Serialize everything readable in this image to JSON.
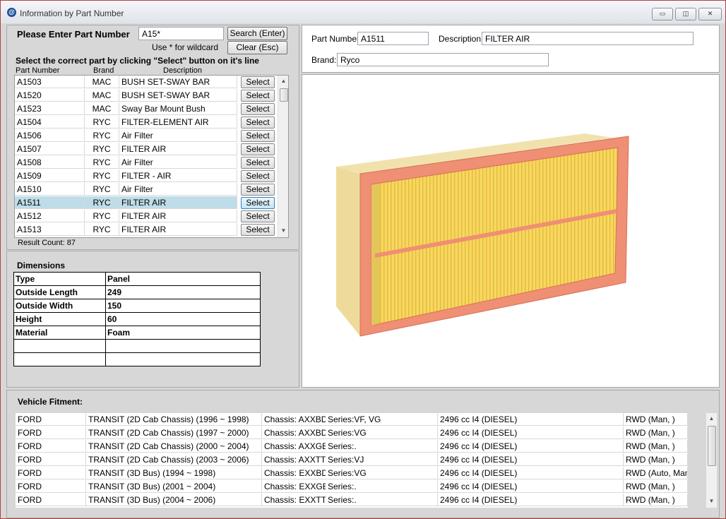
{
  "window": {
    "title": "Information by Part Number",
    "app_icon_glyph": "@",
    "minimize_glyph": "▭",
    "maximize_glyph": "◫",
    "close_glyph": "✕",
    "icons": [
      "app-icon",
      "minimize-icon",
      "maximize-icon",
      "close-icon"
    ]
  },
  "search": {
    "label": "Please Enter Part Number",
    "value": "A15*",
    "hint": "Use * for wildcard",
    "search_button": "Search (Enter)",
    "clear_button": "Clear (Esc)"
  },
  "parts": {
    "instruction": "Select the correct part by clicking \"Select\" button on it's line",
    "columns": [
      "Part Number",
      "Brand",
      "Description"
    ],
    "select_label": "Select",
    "rows": [
      {
        "part": "A1503",
        "brand": "MAC",
        "description": "BUSH SET-SWAY BAR"
      },
      {
        "part": "A1520",
        "brand": "MAC",
        "description": "BUSH SET-SWAY BAR"
      },
      {
        "part": "A1523",
        "brand": "MAC",
        "description": "Sway Bar Mount Bush"
      },
      {
        "part": "A1504",
        "brand": "RYC",
        "description": "FILTER-ELEMENT AIR"
      },
      {
        "part": "A1506",
        "brand": "RYC",
        "description": "Air Filter"
      },
      {
        "part": "A1507",
        "brand": "RYC",
        "description": "FILTER AIR"
      },
      {
        "part": "A1508",
        "brand": "RYC",
        "description": "Air Filter"
      },
      {
        "part": "A1509",
        "brand": "RYC",
        "description": "FILTER - AIR"
      },
      {
        "part": "A1510",
        "brand": "RYC",
        "description": "Air Filter"
      },
      {
        "part": "A1511",
        "brand": "RYC",
        "description": "FILTER AIR"
      },
      {
        "part": "A1512",
        "brand": "RYC",
        "description": "FILTER AIR"
      },
      {
        "part": "A1513",
        "brand": "RYC",
        "description": "FILTER AIR"
      }
    ],
    "selected_index": 9,
    "result_count": "Result Count: 87",
    "scroll_up": "▲",
    "scroll_down": "▼"
  },
  "dimensions": {
    "title": "Dimensions",
    "rows": [
      {
        "key": "Type",
        "value": "Panel"
      },
      {
        "key": "Outside Length",
        "value": "249"
      },
      {
        "key": "Outside Width",
        "value": "150"
      },
      {
        "key": "Height",
        "value": "60"
      },
      {
        "key": "Material",
        "value": "Foam"
      },
      {
        "key": "",
        "value": ""
      },
      {
        "key": "",
        "value": ""
      }
    ]
  },
  "detail": {
    "part_label": "Part Number:",
    "part_value": "A1511",
    "desc_label": "Description:",
    "desc_value": "FILTER AIR",
    "brand_label": "Brand:",
    "brand_value": "Ryco",
    "image_icon": "air-filter-image",
    "frame_color": "#ef8f73",
    "pleat_color": "#f6d860",
    "media_side_color": "#eedb9c"
  },
  "fitment": {
    "title": "Vehicle Fitment:",
    "scroll_up": "▲",
    "scroll_down": "▼",
    "rows": [
      {
        "make": "FORD",
        "model": "TRANSIT  (2D Cab Chassis) (1996 ~ 1998)",
        "chassis": "Chassis: AXXBD",
        "series": "Series:VF, VG",
        "engine": "2496 cc I4  (DIESEL)",
        "drive": "RWD (Man, )"
      },
      {
        "make": "FORD",
        "model": "TRANSIT  (2D Cab Chassis) (1997 ~ 2000)",
        "chassis": "Chassis: AXXBD",
        "series": "Series:VG",
        "engine": "2496 cc I4  (DIESEL)",
        "drive": "RWD (Man, )"
      },
      {
        "make": "FORD",
        "model": "TRANSIT  (2D Cab Chassis) (2000 ~ 2004)",
        "chassis": "Chassis: AXXGB",
        "series": "Series:.",
        "engine": "2496 cc I4  (DIESEL)",
        "drive": "RWD (Man, )"
      },
      {
        "make": "FORD",
        "model": "TRANSIT  (2D Cab Chassis) (2003 ~ 2006)",
        "chassis": "Chassis: AXXTT",
        "series": "Series:VJ",
        "engine": "2496 cc I4  (DIESEL)",
        "drive": "RWD (Man, )"
      },
      {
        "make": "FORD",
        "model": "TRANSIT  (3D Bus) (1994 ~ 1998)",
        "chassis": "Chassis: EXXBD",
        "series": "Series:VG",
        "engine": "2496 cc I4  (DIESEL)",
        "drive": "RWD (Auto, Man,"
      },
      {
        "make": "FORD",
        "model": "TRANSIT  (3D Bus) (2001 ~ 2004)",
        "chassis": "Chassis: EXXGB",
        "series": "Series:.",
        "engine": "2496 cc I4  (DIESEL)",
        "drive": "RWD (Man, )"
      },
      {
        "make": "FORD",
        "model": "TRANSIT  (3D Bus) (2004 ~ 2006)",
        "chassis": "Chassis: EXXTT",
        "series": "Series:.",
        "engine": "2496 cc I4  (DIESEL)",
        "drive": "RWD (Man, )"
      }
    ]
  }
}
